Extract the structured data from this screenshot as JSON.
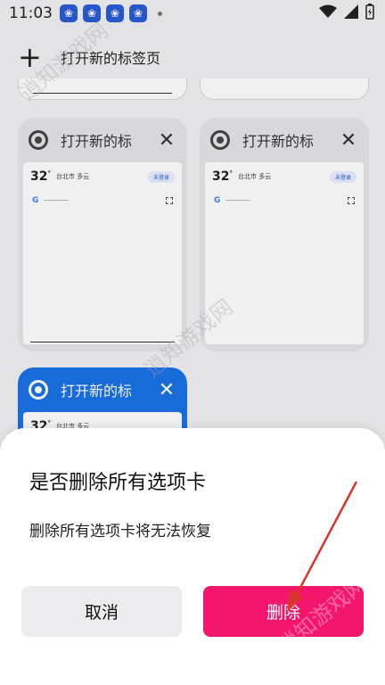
{
  "status_bar": {
    "time": "11:03",
    "app_icons": [
      "baidu-paw-icon",
      "baidu-paw-icon",
      "baidu-paw-icon",
      "baidu-paw-icon"
    ],
    "wifi_icon": "wifi-icon",
    "signal_icon": "signal-icon",
    "battery_icon": "battery-charging-icon"
  },
  "toolbar": {
    "new_tab_label": "打开新的标签页",
    "plus_icon": "+"
  },
  "tabs": [
    {
      "title": "打开新的标",
      "close": "✕",
      "preview": {
        "temp": "32",
        "deg": "°",
        "city": "台北市",
        "weather": "多云",
        "user": "未登录",
        "g": "G"
      }
    },
    {
      "title": "打开新的标",
      "close": "✕",
      "preview": {
        "temp": "32",
        "deg": "°",
        "city": "台北市",
        "weather": "多云",
        "user": "未登录",
        "g": "G"
      }
    },
    {
      "title": "打开新的标",
      "close": "✕",
      "preview": {
        "temp": "32",
        "deg": "°",
        "city": "台北市",
        "weather": "多云",
        "user": "",
        "g": ""
      }
    }
  ],
  "dialog": {
    "title": "是否删除所有选项卡",
    "message": "删除所有选项卡将无法恢复",
    "cancel_label": "取消",
    "delete_label": "删除"
  },
  "watermark": "逍知游戏网",
  "colors": {
    "delete_button": "#f4166d",
    "active_tab": "#1a73e8",
    "annotation_arrow": "#d9352b"
  }
}
